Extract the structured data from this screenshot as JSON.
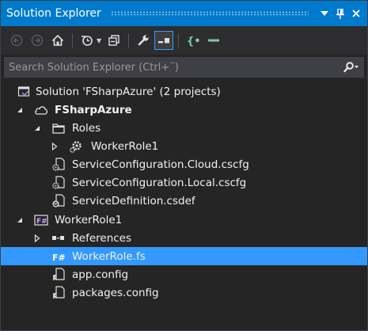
{
  "window": {
    "title": "Solution Explorer",
    "dropdown_glyph": "▼",
    "pin_glyph": "⊥",
    "close_glyph": "✕",
    "accent": "#007acc"
  },
  "toolbar": {
    "buttons": [
      "back-icon",
      "forward-icon",
      "home-icon",
      "history-icon",
      "collapse-all-icon",
      "properties-icon",
      "show-all-files-icon",
      "code-icon",
      "minus-icon"
    ],
    "active": "show-all-files-icon"
  },
  "search": {
    "placeholder": "Search Solution Explorer (Ctrl+¨)",
    "dropdown_glyph": "▾"
  },
  "tree": {
    "selected_color": "#3399ff",
    "items": [
      {
        "label": "Solution 'FSharpAzure' (2 projects)",
        "icon": "solution-icon",
        "expander": "none",
        "bold": false
      },
      {
        "label": "FSharpAzure",
        "icon": "cloud-project-icon",
        "expander": "expanded",
        "bold": true
      },
      {
        "label": "Roles",
        "icon": "folder-icon",
        "expander": "expanded",
        "bold": false
      },
      {
        "label": "WorkerRole1",
        "icon": "worker-role-icon",
        "expander": "collapsed",
        "bold": false
      },
      {
        "label": "ServiceConfiguration.Cloud.cscfg",
        "icon": "config-file-icon",
        "expander": "none",
        "bold": false
      },
      {
        "label": "ServiceConfiguration.Local.cscfg",
        "icon": "config-file-icon",
        "expander": "none",
        "bold": false
      },
      {
        "label": "ServiceDefinition.csdef",
        "icon": "definition-file-icon",
        "expander": "none",
        "bold": false
      },
      {
        "label": "WorkerRole1",
        "icon": "fsharp-project-icon",
        "expander": "expanded",
        "bold": false
      },
      {
        "label": "References",
        "icon": "references-icon",
        "expander": "collapsed",
        "bold": false
      },
      {
        "label": "WorkerRole.fs",
        "icon": "fsharp-file-icon",
        "expander": "none",
        "bold": false,
        "selected": true
      },
      {
        "label": "app.config",
        "icon": "config-file-icon",
        "expander": "none",
        "bold": false
      },
      {
        "label": "packages.config",
        "icon": "config-file-icon",
        "expander": "none",
        "bold": false
      }
    ]
  }
}
